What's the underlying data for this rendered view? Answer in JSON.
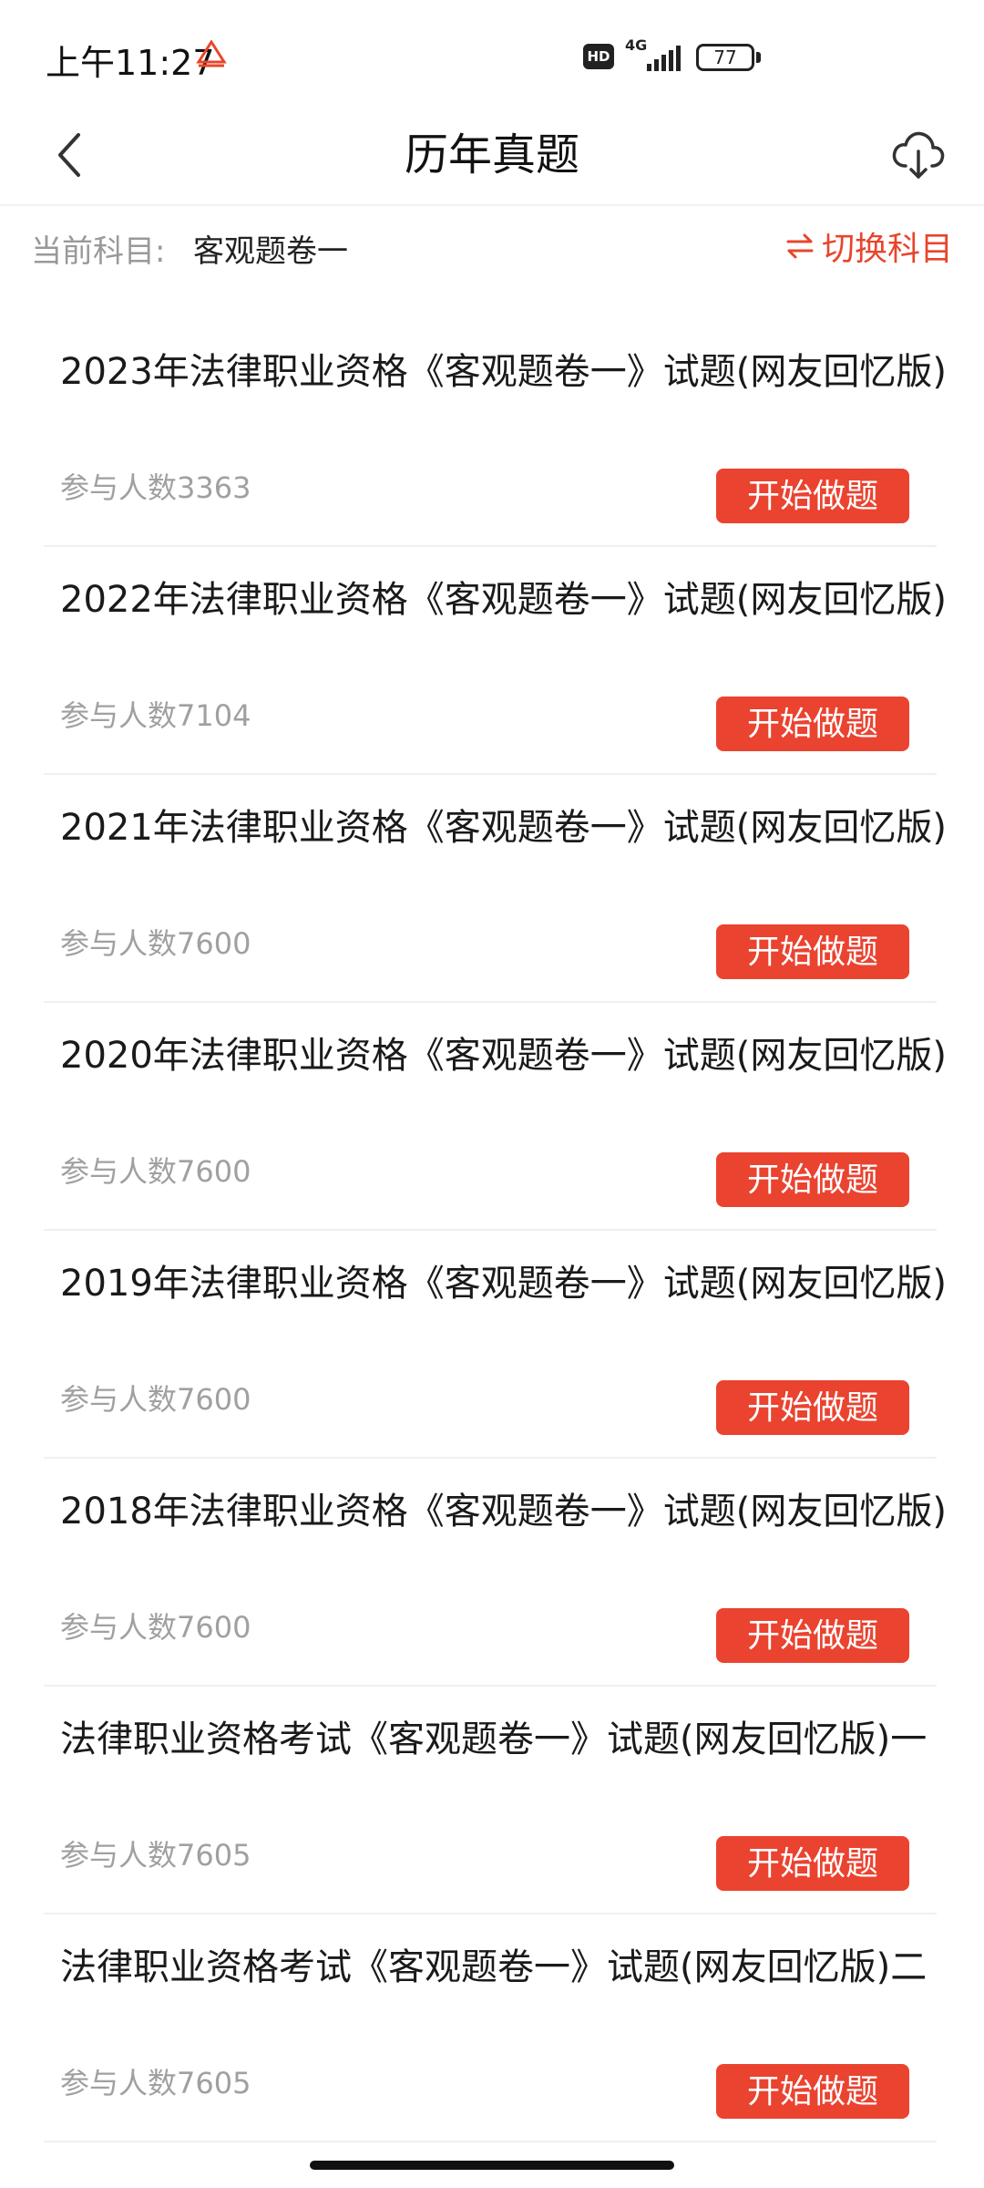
{
  "status_bar": {
    "time": "上午11:27",
    "hd": "HD",
    "network": "4G",
    "battery": "77"
  },
  "header": {
    "title": "历年真题"
  },
  "subject": {
    "label": "当前科目:",
    "value": "客观题卷一",
    "switch_label": "切换科目"
  },
  "colors": {
    "accent": "#ea4330",
    "muted_text": "#a0a0a0"
  },
  "items": [
    {
      "title": "2023年法律职业资格《客观题卷一》试题(网友回忆版)",
      "count": "参与人数3363",
      "button": "开始做题"
    },
    {
      "title": "2022年法律职业资格《客观题卷一》试题(网友回忆版)",
      "count": "参与人数7104",
      "button": "开始做题"
    },
    {
      "title": "2021年法律职业资格《客观题卷一》试题(网友回忆版)",
      "count": "参与人数7600",
      "button": "开始做题"
    },
    {
      "title": "2020年法律职业资格《客观题卷一》试题(网友回忆版)",
      "count": "参与人数7600",
      "button": "开始做题"
    },
    {
      "title": "2019年法律职业资格《客观题卷一》试题(网友回忆版)",
      "count": "参与人数7600",
      "button": "开始做题"
    },
    {
      "title": "2018年法律职业资格《客观题卷一》试题(网友回忆版)",
      "count": "参与人数7600",
      "button": "开始做题"
    },
    {
      "title": "法律职业资格考试《客观题卷一》试题(网友回忆版)一",
      "count": "参与人数7605",
      "button": "开始做题"
    },
    {
      "title": "法律职业资格考试《客观题卷一》试题(网友回忆版)二",
      "count": "参与人数7605",
      "button": "开始做题"
    }
  ]
}
